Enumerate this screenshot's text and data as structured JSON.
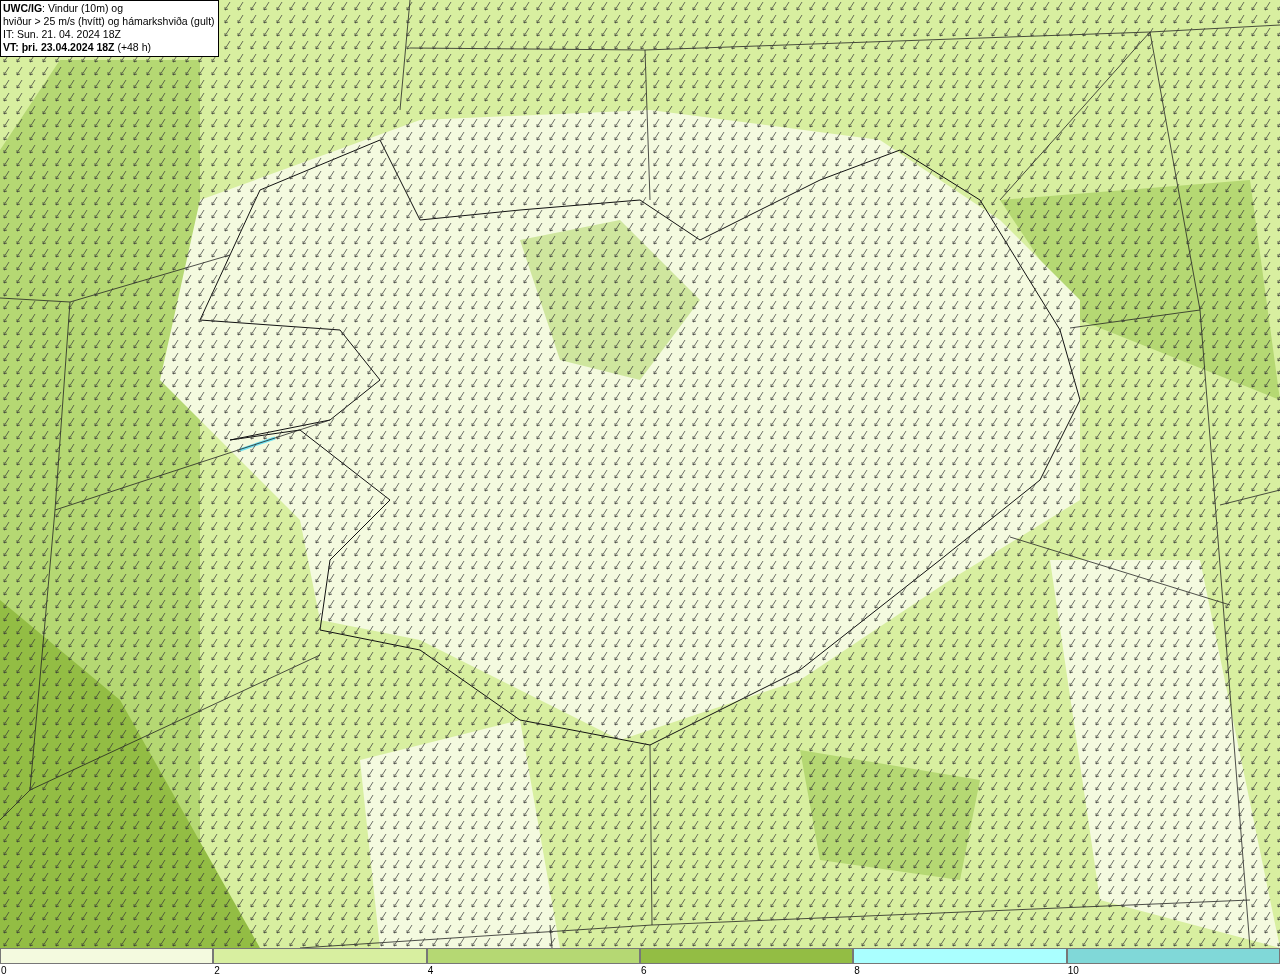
{
  "info_box": {
    "lines": [
      "**UWC/IG**: Vindur (10m) og",
      "hviður > 25 m/s (hvítt) og hámarkshviða (gult)",
      "IT: Sun. 21. 04. 2024 18Z",
      "**VT: þri. 23.04.2024 18Z** (+48 h)"
    ]
  },
  "legend": {
    "bins": [
      {
        "label": "0",
        "color": "#f4fadf"
      },
      {
        "label": "2",
        "color": "#d8efa0"
      },
      {
        "label": "4",
        "color": "#b5d873"
      },
      {
        "label": "6",
        "color": "#93bd44"
      },
      {
        "label": "8",
        "color": "#aaffff"
      },
      {
        "label": "10",
        "color": "#80d8d8"
      }
    ]
  }
}
